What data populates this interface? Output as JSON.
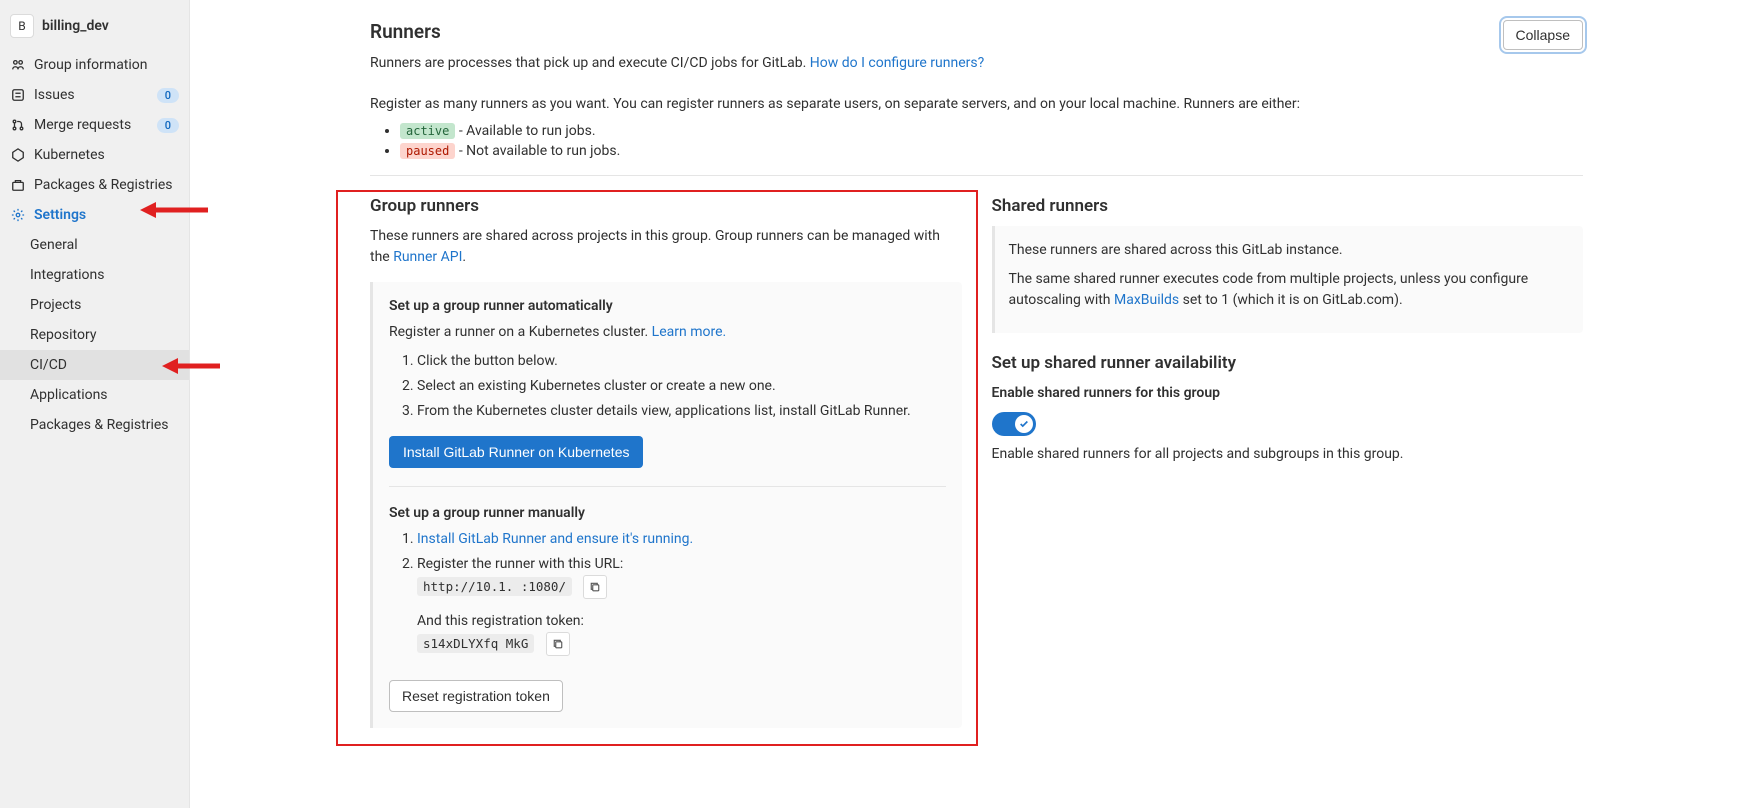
{
  "project": {
    "avatar_letter": "B",
    "name": "billing_dev"
  },
  "nav": {
    "group_info": "Group information",
    "issues": "Issues",
    "issues_count": "0",
    "merge_requests": "Merge requests",
    "mr_count": "0",
    "kubernetes": "Kubernetes",
    "packages": "Packages & Registries",
    "settings": "Settings",
    "sub": {
      "general": "General",
      "integrations": "Integrations",
      "projects": "Projects",
      "repository": "Repository",
      "cicd": "CI/CD",
      "applications": "Applications",
      "packages": "Packages & Registries"
    }
  },
  "runners": {
    "title": "Runners",
    "collapse": "Collapse",
    "intro_text": "Runners are processes that pick up and execute CI/CD jobs for GitLab. ",
    "intro_link": "How do I configure runners?",
    "register_text": "Register as many runners as you want. You can register runners as separate users, on separate servers, and on your local machine. Runners are either:",
    "state_active": "active",
    "state_active_desc": " - Available to run jobs.",
    "state_paused": "paused",
    "state_paused_desc": " - Not available to run jobs."
  },
  "group_runners": {
    "title": "Group runners",
    "desc_a": "These runners are shared across projects in this group. Group runners can be managed with the ",
    "runner_api": "Runner API",
    "auto_title": "Set up a group runner automatically",
    "auto_desc": "Register a runner on a Kubernetes cluster. ",
    "learn_more": "Learn more.",
    "step1": "Click the button below.",
    "step2": "Select an existing Kubernetes cluster or create a new one.",
    "step3": "From the Kubernetes cluster details view, applications list, install GitLab Runner.",
    "install_btn": "Install GitLab Runner on Kubernetes",
    "manual_title": "Set up a group runner manually",
    "manual_step1": "Install GitLab Runner and ensure it's running.",
    "manual_step2": "Register the runner with this URL:",
    "url_value": "http://10.1.      :1080/",
    "token_label": "And this registration token:",
    "token_value": "s14xDLYXfq       MkG",
    "reset_btn": "Reset registration token"
  },
  "shared_runners": {
    "title": "Shared runners",
    "info1": "These runners are shared across this GitLab instance.",
    "info2a": "The same shared runner executes code from multiple projects, unless you configure autoscaling with ",
    "maxbuilds": "MaxBuilds",
    "info2b": " set to 1 (which it is on GitLab.com).",
    "setup_title": "Set up shared runner availability",
    "enable_label": "Enable shared runners for this group",
    "enable_desc": "Enable shared runners for all projects and subgroups in this group."
  }
}
